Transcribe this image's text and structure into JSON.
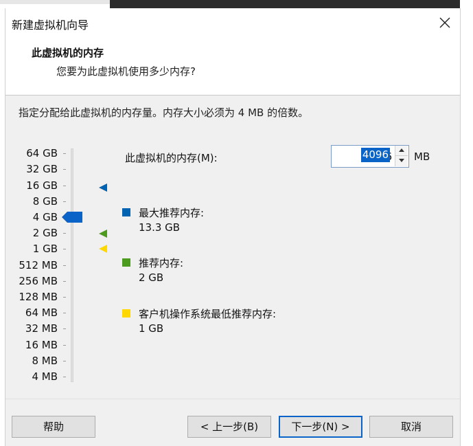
{
  "window": {
    "title": "新建虚拟机向导",
    "close_icon": "close-icon"
  },
  "header": {
    "heading": "此虚拟机的内存",
    "subheading": "您要为此虚拟机使用多少内存?"
  },
  "instruction": "指定分配给此虚拟机的内存量。内存大小必须为 4 MB 的倍数。",
  "scale": {
    "labels": [
      "64 GB",
      "32 GB",
      "16 GB",
      "8 GB",
      "4 GB",
      "2 GB",
      "1 GB",
      "512 MB",
      "256 MB",
      "128 MB",
      "64 MB",
      "32 MB",
      "16 MB",
      "8 MB",
      "4 MB"
    ],
    "selected": "4 GB",
    "markers": {
      "max_recommended": "16 GB",
      "recommended": "2 GB",
      "guest_min": "1 GB"
    }
  },
  "memory": {
    "label": "此虚拟机的内存(M):",
    "value": "4096",
    "unit": "MB"
  },
  "legend": [
    {
      "title": "最大推荐内存:",
      "value": "13.3 GB",
      "color": "#0063b1"
    },
    {
      "title": "推荐内存:",
      "value": "2 GB",
      "color": "#4c9a1e"
    },
    {
      "title": "客户机操作系统最低推荐内存:",
      "value": "1 GB",
      "color": "#ffd800"
    }
  ],
  "buttons": {
    "help": "帮助",
    "back": "< 上一步(B)",
    "next": "下一步(N) >",
    "cancel": "取消"
  },
  "colors": {
    "accent": "#0a64c8",
    "thumb": "#0a64c8"
  }
}
